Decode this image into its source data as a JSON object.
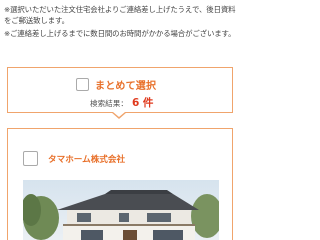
{
  "notes": [
    "※選択いただいた注文住宅会社よりご連絡差し上げたうえで、後日資料をご郵送致します。",
    "※ご連絡差し上げるまでに数日間のお時間がかかる場合がございます。"
  ],
  "selection": {
    "label": "まとめて選択",
    "result_label": "検索結果：",
    "result_count": "6 件"
  },
  "companies": [
    {
      "name": "タマホーム株式会社"
    }
  ],
  "colors": {
    "accent": "#e8702a",
    "border": "#f0a46c",
    "count": "#e03a1e"
  }
}
